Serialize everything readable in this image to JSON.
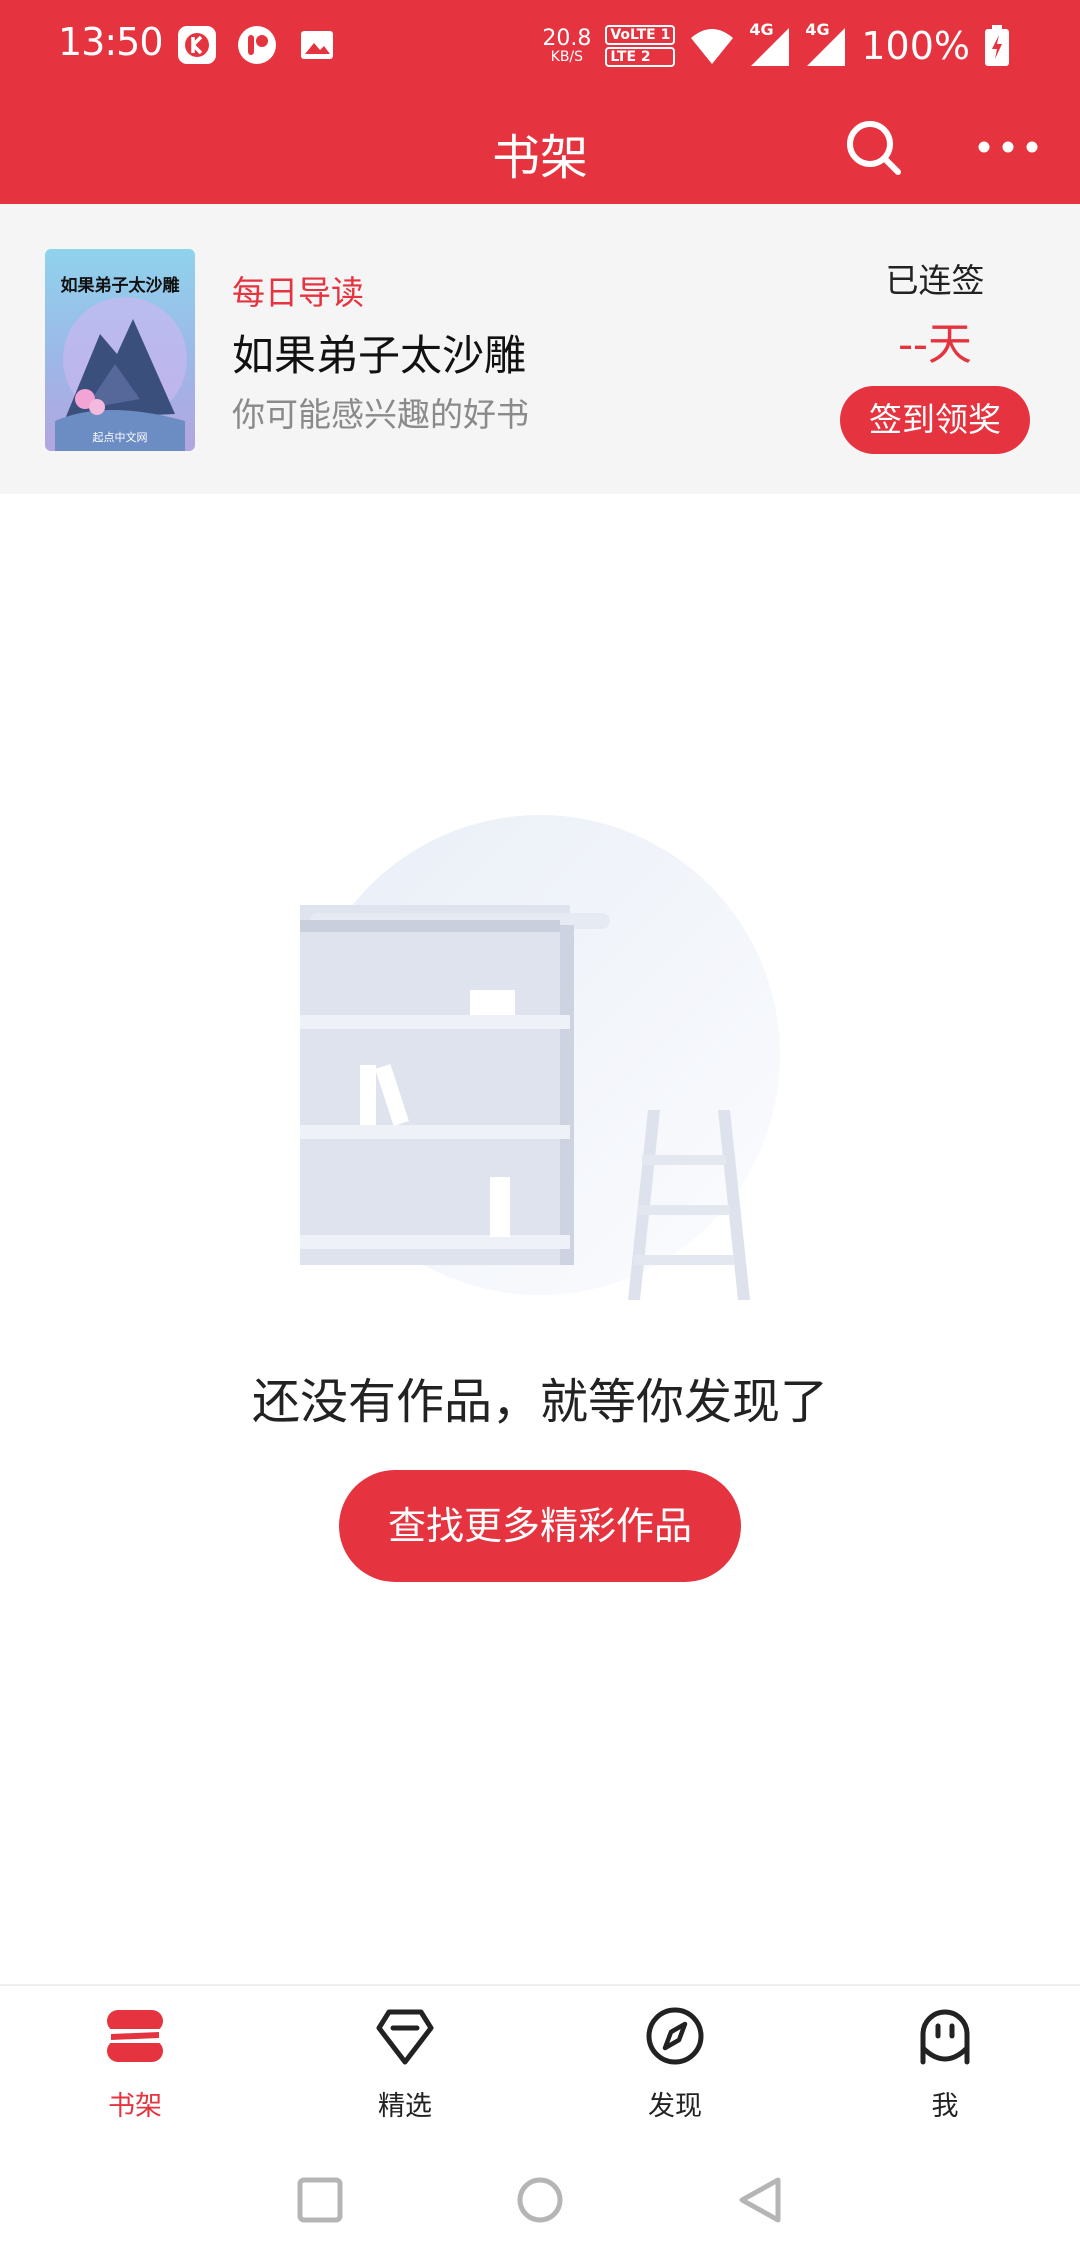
{
  "status_bar": {
    "time": "13:50",
    "net_speed_value": "20.8",
    "net_speed_unit": "KB/S",
    "lte_label_1": "VoLTE 1",
    "lte_label_2": "LTE 2",
    "signal_1_label": "4G",
    "signal_2_label": "4G",
    "battery": "100%"
  },
  "header": {
    "title": "书架"
  },
  "daily_recommend": {
    "tag": "每日导读",
    "book_title": "如果弟子太沙雕",
    "subtitle": "你可能感兴趣的好书",
    "cover_title": "如果弟子太沙雕",
    "cover_footer": "起点中文网"
  },
  "checkin": {
    "label": "已连签",
    "days": "--天",
    "button": "签到领奖"
  },
  "empty_state": {
    "message": "还没有作品，就等你发现了",
    "button": "查找更多精彩作品"
  },
  "tabs": [
    {
      "label": "书架",
      "icon": "bookshelf-icon",
      "active": true
    },
    {
      "label": "精选",
      "icon": "diamond-icon",
      "active": false
    },
    {
      "label": "发现",
      "icon": "compass-icon",
      "active": false
    },
    {
      "label": "我",
      "icon": "profile-face-icon",
      "active": false
    }
  ],
  "colors": {
    "accent": "#E5343F",
    "banner_bg": "#F5F5F5",
    "muted_text": "#8A8A8A"
  }
}
